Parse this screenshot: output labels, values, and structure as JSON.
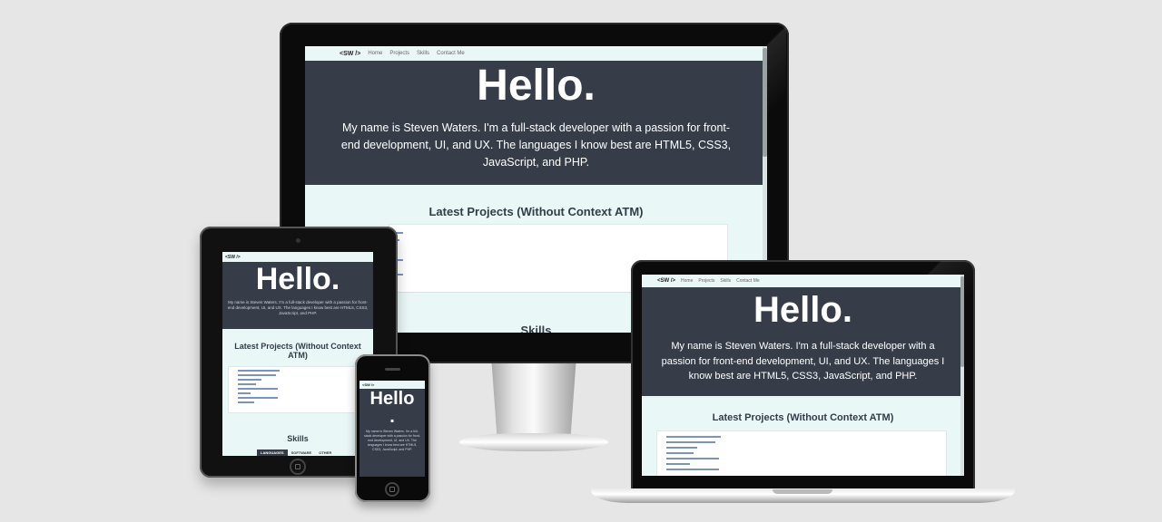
{
  "site": {
    "logo": "<SW />",
    "nav": [
      "Home",
      "Projects",
      "Skills",
      "Contact Me"
    ],
    "hero_title": "Hello.",
    "hero_text": "My name is Steven Waters. I'm a full-stack developer with a passion for front-end development, UI, and UX. The languages I know best are HTML5, CSS3, JavaScript, and PHP.",
    "projects_title": "Latest Projects (Without Context ATM)",
    "skills_title": "Skills",
    "skill_tabs": [
      "LANGUAGES",
      "SOFTWARE",
      "OTHER"
    ]
  },
  "phone": {
    "hello_line1": "Hello",
    "hello_line2": "."
  },
  "colors": {
    "page_bg": "#e6e6e6",
    "hero_bg": "#363d49",
    "site_bg": "#eaf7f7",
    "link": "#3563c2",
    "device_frame": "#0b0b0b"
  }
}
